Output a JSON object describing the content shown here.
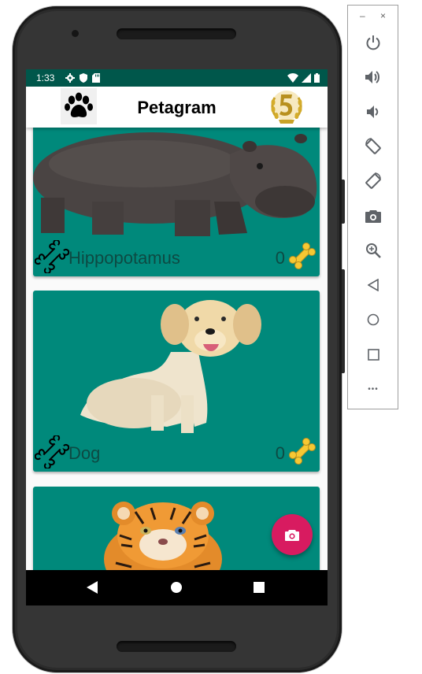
{
  "status_bar": {
    "time": "1:33"
  },
  "app_bar": {
    "title": "Petagram"
  },
  "pets": [
    {
      "name": "Hippopotamus",
      "likes": "0"
    },
    {
      "name": "Dog",
      "likes": "0"
    }
  ],
  "colors": {
    "card": "#00897b",
    "status_bar": "#00574b",
    "fab": "#d81b60",
    "bone_yellow": "#f6c833"
  },
  "emulator_toolbar": {
    "minimize": "–",
    "close": "×",
    "more": "•••"
  }
}
